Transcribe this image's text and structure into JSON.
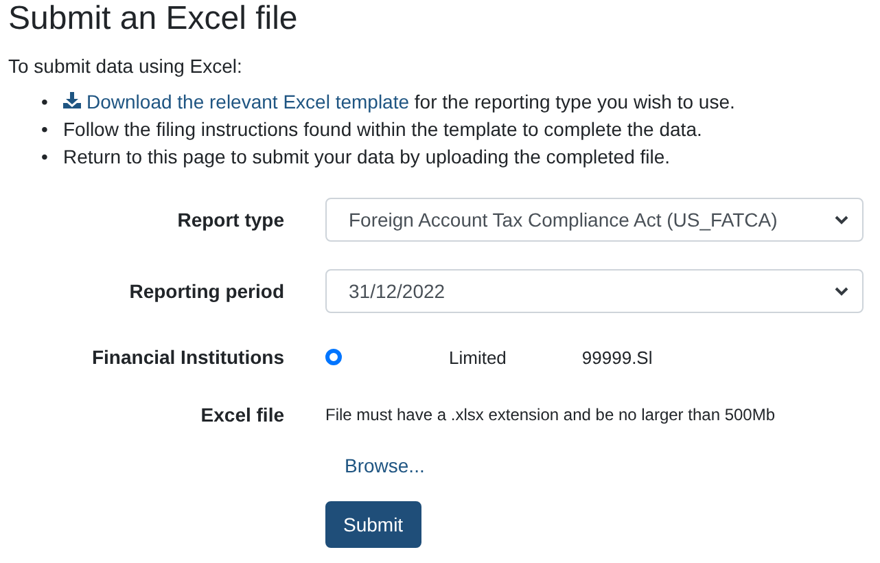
{
  "title": "Submit an Excel file",
  "intro": "To submit data using Excel:",
  "steps": [
    {
      "marker": "•",
      "link": "Download the relevant Excel template",
      "text": " for the reporting type you wish to use."
    },
    {
      "marker": "•",
      "text": "Follow the filing instructions found within the template to complete the data."
    },
    {
      "marker": "•",
      "text": "Return to this page to submit your data by uploading the completed file."
    }
  ],
  "form": {
    "report_type": {
      "label": "Report type",
      "value": "Foreign Account Tax Compliance Act (US_FATCA)"
    },
    "reporting_period": {
      "label": "Reporting period",
      "value": "31/12/2022"
    },
    "financial_institutions": {
      "label": "Financial Institutions",
      "options": [
        {
          "name": "Limited",
          "code": "99999.Sl",
          "selected": true
        }
      ]
    },
    "excel_file": {
      "label": "Excel file",
      "hint": "File must have a .xlsx extension and be no larger than 500Mb",
      "browse": "Browse..."
    },
    "submit": "Submit"
  }
}
